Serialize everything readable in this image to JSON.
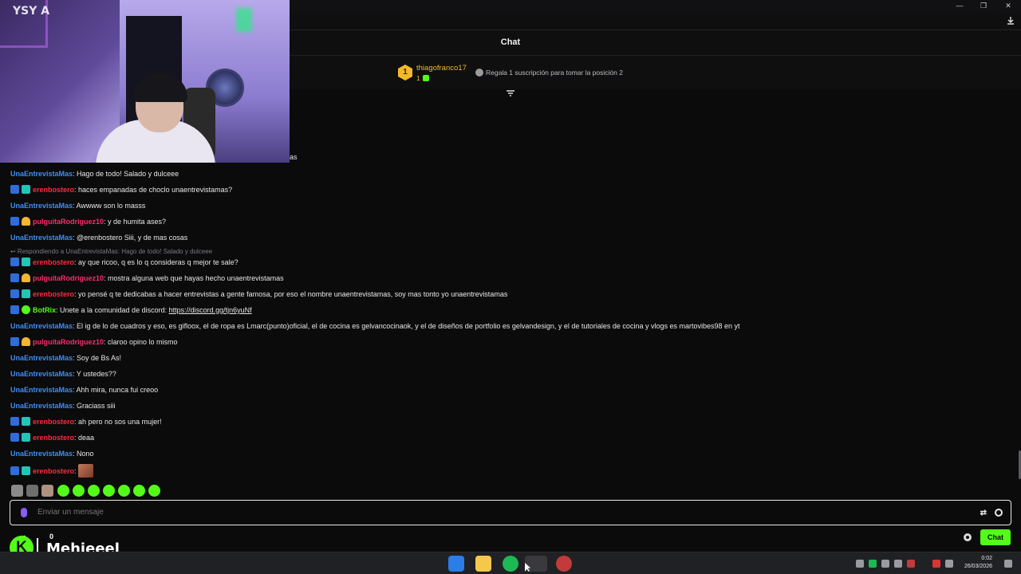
{
  "window": {
    "minimize": "—",
    "maximize": "❐",
    "close": "✕"
  },
  "chat_header": {
    "title": "Chat"
  },
  "pinned": {
    "rank": "1",
    "user": "thiagofranco17",
    "count": "1",
    "info": "Regala 1 suscripción para tomar la posición 2"
  },
  "cam_overlay": {
    "logo_text": "YSY A",
    "tail_text": "as"
  },
  "messages": [
    {
      "badges": [],
      "user": "UnaEntrevistaMas",
      "color": "blue",
      "text": ": Hago de todo! Salado y dulceee"
    },
    {
      "badges": [
        "mod",
        "sub"
      ],
      "user": "erenbostero",
      "color": "red",
      "text": ": haces empanadas de choclo unaentrevistamas?"
    },
    {
      "badges": [],
      "user": "UnaEntrevistaMas",
      "color": "blue",
      "text": ": Awwww son lo masss"
    },
    {
      "badges": [
        "mod",
        "gift"
      ],
      "user": "pulguitaRodriguez10",
      "color": "pink",
      "text": ": y de humita ases?"
    },
    {
      "badges": [],
      "user": "UnaEntrevistaMas",
      "color": "blue",
      "text": ": @erenbostero Siii, y de mas cosas"
    },
    {
      "reply": "Respondiendo a UnaEntrevistaMas: Hago de todo! Salado y dulceee",
      "badges": [
        "mod",
        "sub"
      ],
      "user": "erenbostero",
      "color": "red",
      "text": ": ay que ricoo, q es lo q consideras q mejor te sale?"
    },
    {
      "badges": [
        "mod",
        "gift"
      ],
      "user": "pulguitaRodriguez10",
      "color": "pink",
      "text": ": mostra alguna web que hayas hecho unaentrevistamas"
    },
    {
      "badges": [
        "mod",
        "sub"
      ],
      "user": "erenbostero",
      "color": "red",
      "text": ": yo pensé q te dedicabas a hacer entrevistas a gente famosa, por eso el nombre unaentrevistamas, soy mas tonto yo unaentrevistamas"
    },
    {
      "badges": [
        "mod",
        "bot"
      ],
      "user": "BotRix",
      "color": "green",
      "text": ": Unete a la comunidad de discord: ",
      "link": "https://discord.gg/tjn6yuNf"
    },
    {
      "badges": [],
      "user": "UnaEntrevistaMas",
      "color": "blue",
      "text": ": El ig de lo de cuadros y eso, es gifloox, el de ropa es Lmarc(punto)oficial, el de cocina es gelvancocinaok, y el de diseños de portfolio es gelvandesign, y el de tutoriales de cocina y vlogs es martovibes98 en yt"
    },
    {
      "badges": [
        "mod",
        "gift"
      ],
      "user": "pulguitaRodriguez10",
      "color": "pink",
      "text": ": claroo opino lo mismo"
    },
    {
      "badges": [],
      "user": "UnaEntrevistaMas",
      "color": "blue",
      "text": ": Soy de Bs As!"
    },
    {
      "badges": [],
      "user": "UnaEntrevistaMas",
      "color": "blue",
      "text": ": Y ustedes??"
    },
    {
      "badges": [],
      "user": "UnaEntrevistaMas",
      "color": "blue",
      "text": ": Ahh mira, nunca fui creoo"
    },
    {
      "badges": [],
      "user": "UnaEntrevistaMas",
      "color": "blue",
      "text": ": Graciass siii"
    },
    {
      "badges": [
        "mod",
        "sub"
      ],
      "user": "erenbostero",
      "color": "red",
      "text": ": ah pero no sos una mujer!"
    },
    {
      "badges": [
        "mod",
        "sub"
      ],
      "user": "erenbostero",
      "color": "red",
      "text": ": deaa"
    },
    {
      "badges": [],
      "user": "UnaEntrevistaMas",
      "color": "blue",
      "text": ": Nono"
    },
    {
      "badges": [
        "mod",
        "sub"
      ],
      "user": "erenbostero",
      "color": "red",
      "text": ": ",
      "emote": true
    }
  ],
  "input": {
    "placeholder": "Enviar un mensaje"
  },
  "bottom": {
    "viewers": "∞",
    "gifts": "0",
    "streamer": "Mehieeel",
    "chat_button": "Chat"
  },
  "taskbar": {
    "time": "0:02",
    "date": "26/03/2026"
  },
  "colors": {
    "accent": "#53fc18",
    "blue_user": "#3e8ef7",
    "red_user": "#ff2b3c"
  }
}
